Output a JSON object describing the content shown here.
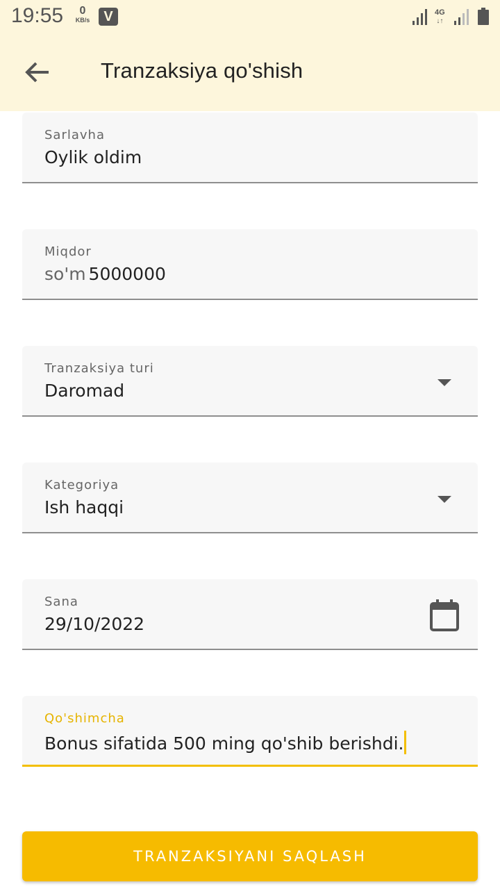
{
  "status_bar": {
    "time": "19:55",
    "net_speed_value": "0",
    "net_speed_unit": "KB/s",
    "app_badge": "V",
    "network_type": "4G",
    "icons": [
      "signal-icon",
      "network-4g-icon",
      "signal-icon",
      "battery-icon"
    ]
  },
  "app_bar": {
    "back_icon": "arrow-left-icon",
    "title": "Tranzaksiya qo'shish"
  },
  "form": {
    "title_field": {
      "label": "Sarlavha",
      "value": "Oylik oldim"
    },
    "amount_field": {
      "label": "Miqdor",
      "prefix": "so'm",
      "value": "5000000"
    },
    "type_field": {
      "label": "Tranzaksiya turi",
      "value": "Daromad",
      "icon": "dropdown-arrow-icon"
    },
    "category_field": {
      "label": "Kategoriya",
      "value": "Ish haqqi",
      "icon": "dropdown-arrow-icon"
    },
    "date_field": {
      "label": "Sana",
      "value": "29/10/2022",
      "icon": "calendar-icon"
    },
    "note_field": {
      "label": "Qo'shimcha",
      "value": "Bonus sifatida 500 ming qo'shib berishdi."
    }
  },
  "save_button": {
    "label": "TRANZAKSIYANI SAQLASH"
  },
  "colors": {
    "app_bar_bg": "#fdf6dc",
    "accent": "#f6bb00",
    "field_bg": "#f7f7f7",
    "text": "#222222"
  }
}
